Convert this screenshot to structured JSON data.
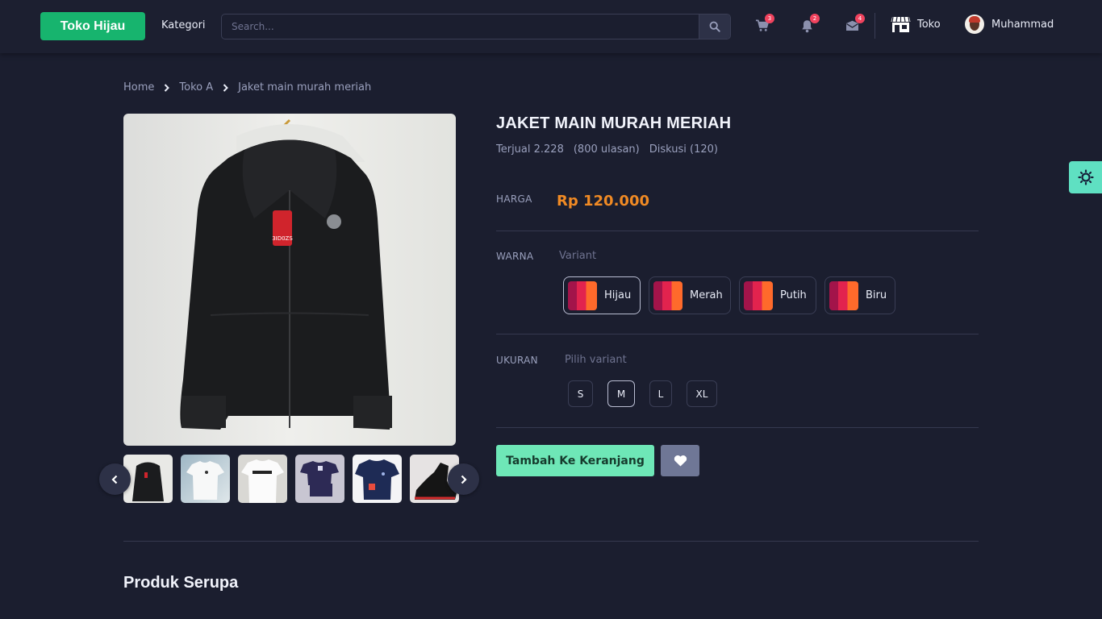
{
  "header": {
    "logo": "Toko Hijau",
    "kategori": "Kategori",
    "search_placeholder": "Search...",
    "cart_count": "3",
    "notif_count": "2",
    "mail_count": "4",
    "toko_label": "Toko",
    "user_name": "Muhammad"
  },
  "breadcrumb": [
    "Home",
    "Toko A",
    "Jaket main murah meriah"
  ],
  "product": {
    "title": "JAKET MAIN MURAH MERIAH",
    "sold": "Terjual 2.228",
    "reviews": "(800 ulasan)",
    "discussion": "Diskusi (120)",
    "price_label": "HARGA",
    "price": "Rp 120.000",
    "color_label": "WARNA",
    "color_hint": "Variant",
    "colors": [
      "Hijau",
      "Merah",
      "Putih",
      "Biru"
    ],
    "selected_color": "Hijau",
    "size_label": "UKURAN",
    "size_hint": "Pilih variant",
    "sizes": [
      "S",
      "M",
      "L",
      "XL"
    ],
    "selected_size": "M",
    "add_to_cart": "Tambah Ke Keranjang"
  },
  "similar_title": "Produk Serupa",
  "colors": {
    "accent": "#17b46e",
    "price": "#f08a24",
    "cart_button": "#6ee7b7",
    "badge": "#f0435e",
    "theme_toggle": "#5fe0c2"
  }
}
